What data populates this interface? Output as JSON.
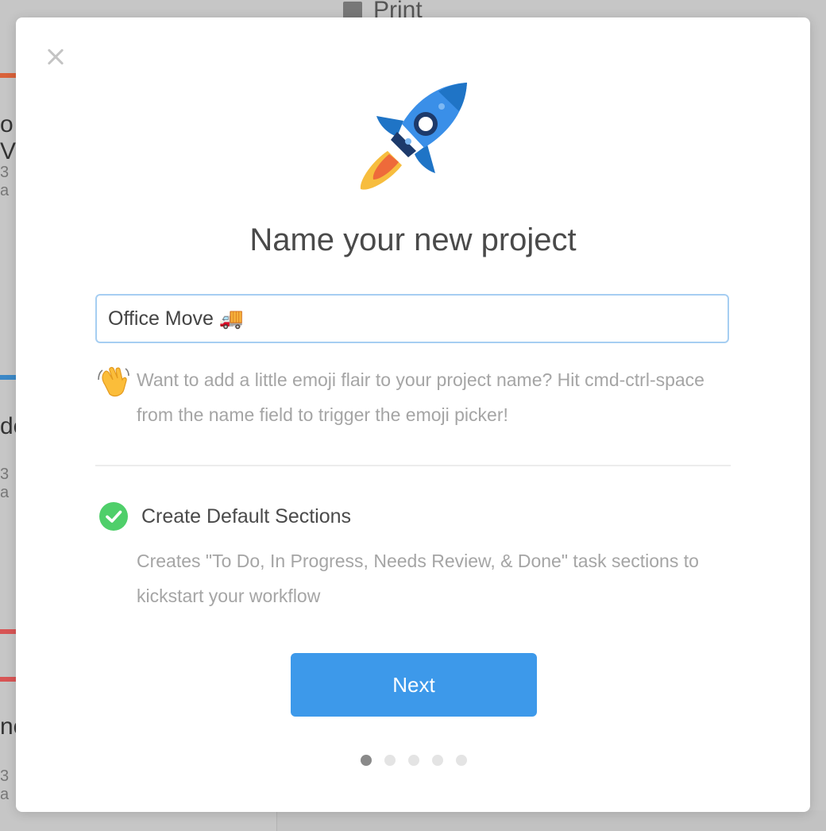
{
  "background": {
    "print_label": "Print",
    "cards": [
      {
        "letter": "o V",
        "sub": "3 a",
        "stripe": "#d9623a"
      },
      {
        "letter": "de",
        "sub": "3 a",
        "stripe": "#3b88c7"
      },
      {
        "letter": "no",
        "sub": "3 a",
        "stripe": "#d85555"
      }
    ]
  },
  "modal": {
    "close_icon": "close-icon",
    "hero_icon": "rocket-icon",
    "title": "Name your new project",
    "name_input": {
      "value": "Office Move 🚚",
      "placeholder": ""
    },
    "hint": {
      "icon": "waving-hand-icon",
      "text": "Want to add a little emoji flair to your project name? Hit cmd-ctrl-space from the name field to trigger the emoji picker!"
    },
    "option": {
      "checked": true,
      "check_color": "#4fcf6a",
      "title": "Create Default Sections",
      "description": "Creates \"To Do, In Progress, Needs Review, & Done\" task sections to kickstart your workflow"
    },
    "next_button": {
      "label": "Next",
      "color": "#3d99ea"
    },
    "pagination": {
      "total": 5,
      "current": 1
    }
  }
}
